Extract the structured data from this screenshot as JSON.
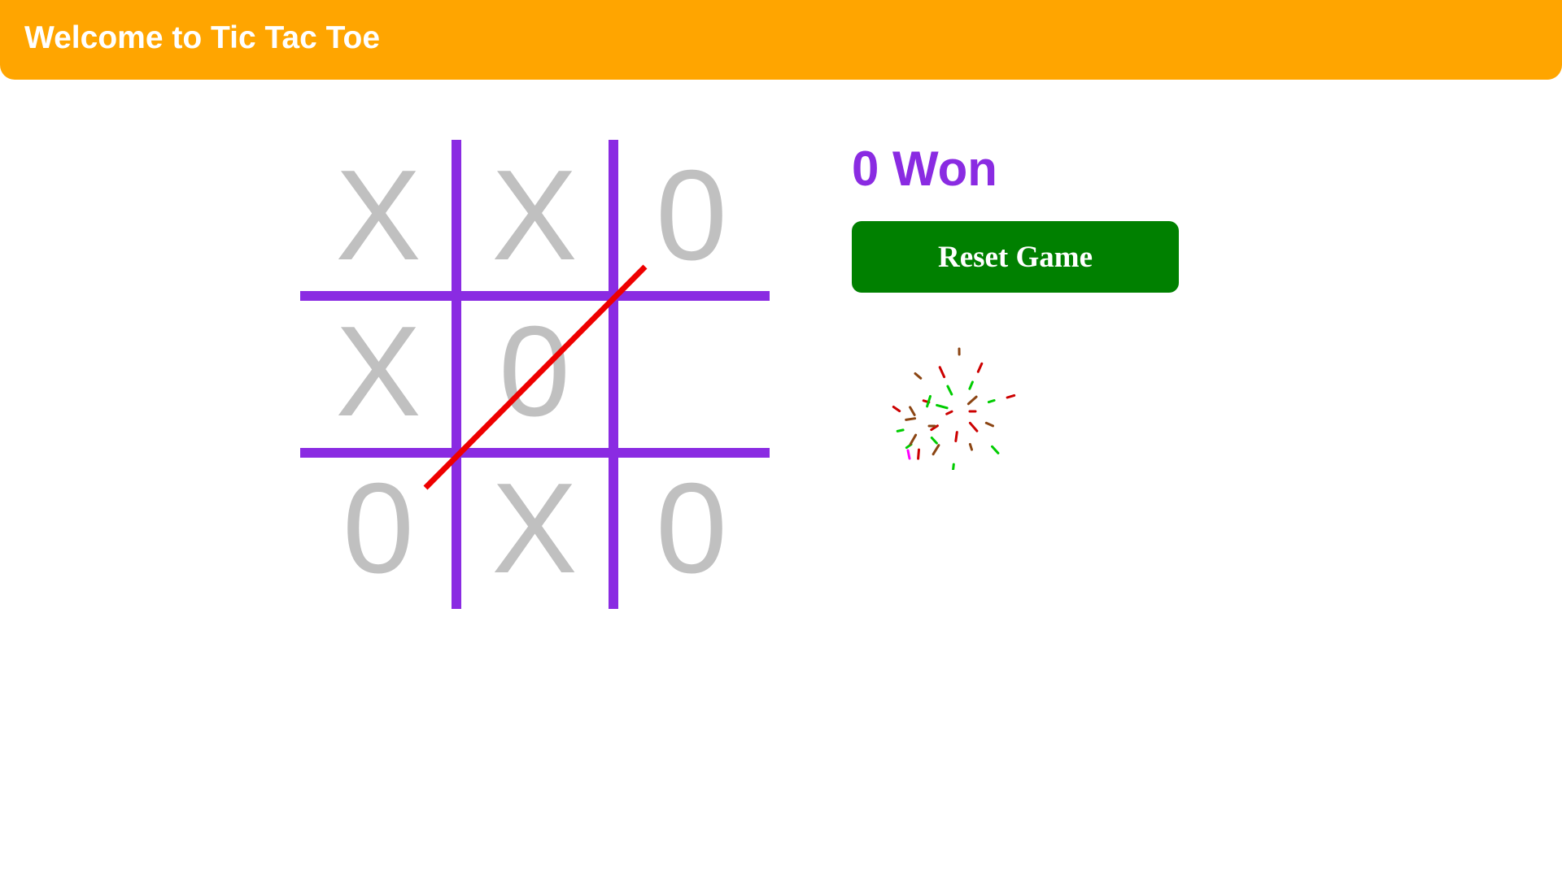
{
  "navbar": {
    "title": "Welcome to Tic Tac Toe"
  },
  "board": {
    "cells": [
      "X",
      "X",
      "0",
      "X",
      "0",
      "",
      "0",
      "X",
      "0"
    ],
    "winning_line": [
      2,
      4,
      6
    ],
    "grid_color": "#8a2be2",
    "mark_color": "#c0c0c0",
    "win_line_color": "#ee0000"
  },
  "status": {
    "winner_text": "0 Won",
    "color": "#8a2be2"
  },
  "controls": {
    "reset_label": "Reset Game",
    "reset_color": "#008000"
  },
  "colors": {
    "navbar": "#ffa500",
    "background": "#ffffff"
  },
  "celebration": {
    "icon": "fireworks-icon",
    "colors": [
      "#cc0000",
      "#8b4513",
      "#00cc00",
      "#ff00ff"
    ]
  }
}
